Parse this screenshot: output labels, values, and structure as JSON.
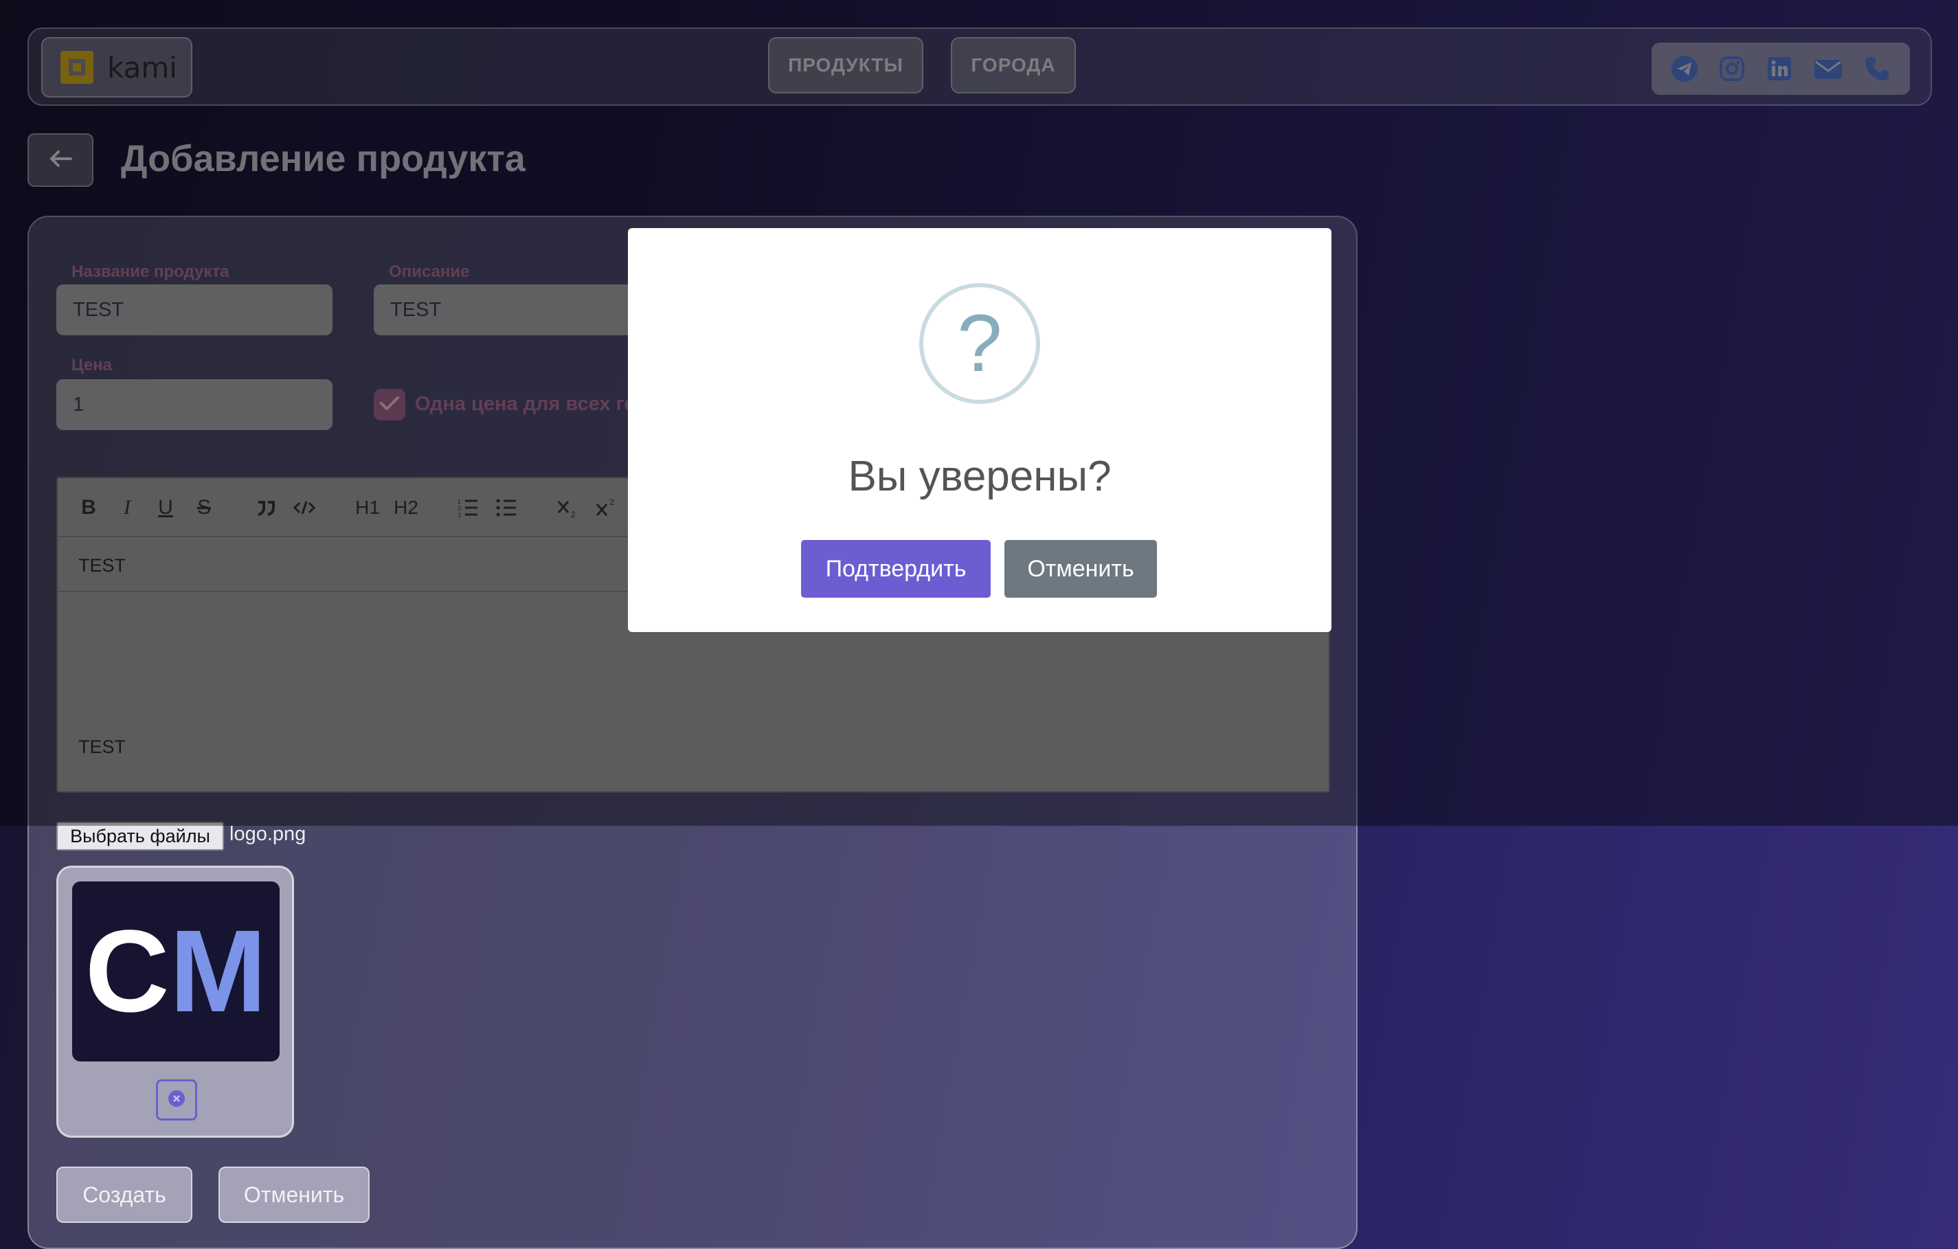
{
  "header": {
    "logo_text": "kami",
    "nav": [
      {
        "label": "ПРОДУКТЫ"
      },
      {
        "label": "ГОРОДА"
      }
    ],
    "social_icons": [
      "telegram-icon",
      "instagram-icon",
      "linkedin-icon",
      "mail-icon",
      "phone-icon"
    ],
    "social_icon_color": "#4f73c9",
    "logo_color": "#c9a31a"
  },
  "page": {
    "title": "Добавление продукта"
  },
  "form": {
    "name_label": "Название продукта",
    "name_value": "TEST",
    "description_label": "Описание",
    "description_value": "TEST",
    "price_label": "Цена",
    "price_value": "1",
    "same_price_checked": true,
    "same_price_label": "Одна цена для всех го",
    "editor": {
      "toolbar": [
        "B",
        "I",
        "U",
        "S",
        "quote-icon",
        "code-icon",
        "H1",
        "H2",
        "ordered-list-icon",
        "bullet-list-icon",
        "subscript-icon",
        "superscript-icon"
      ],
      "line1": "TEST",
      "line2": "TEST"
    },
    "file_button": "Выбрать файлы",
    "file_name": "logo.png",
    "thumbnail": {
      "letter1": "C",
      "letter2": "M",
      "letter1_color": "#ffffff",
      "letter2_color": "#7b93e8"
    },
    "create_button": "Создать",
    "cancel_button": "Отменить",
    "accent_label_color": "#a46a8e"
  },
  "modal": {
    "icon": "?",
    "title": "Вы уверены?",
    "confirm": "Подтвердить",
    "cancel": "Отменить",
    "confirm_color": "#6c5dd3",
    "cancel_color": "#6e7881"
  }
}
